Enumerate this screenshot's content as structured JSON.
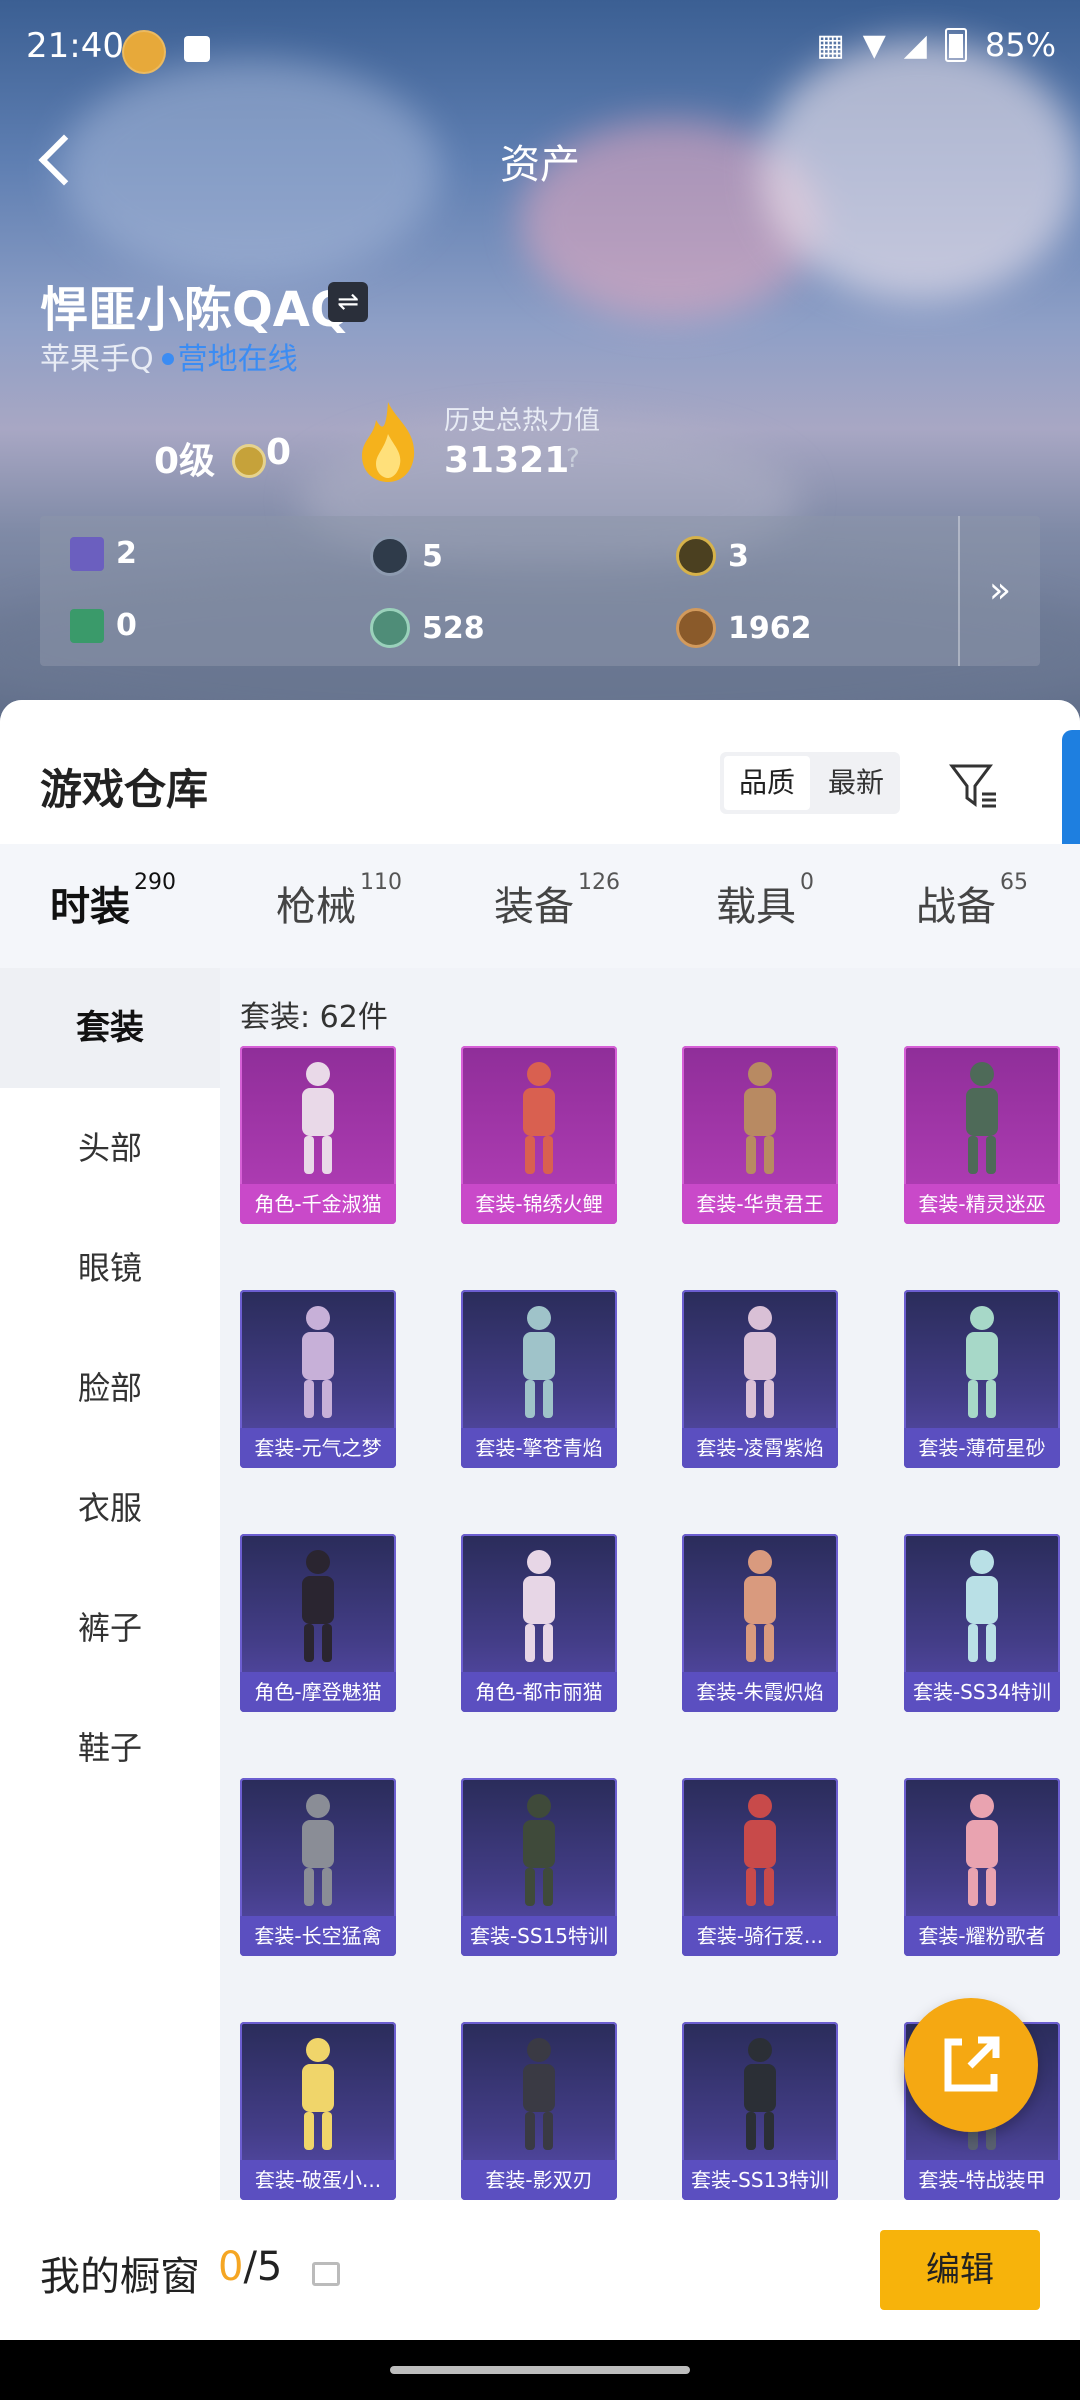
{
  "status_bar": {
    "time": "21:40",
    "battery": "85%"
  },
  "header": {
    "title": "资产"
  },
  "profile": {
    "name": "悍匪小陈QAQ",
    "swap_symbol": "⇌",
    "platform": "苹果手Q",
    "online_status": "营地在线",
    "level": "0级",
    "medal_value": "0",
    "history_label": "历史总热力值",
    "history_value": "31321",
    "help": "?"
  },
  "stats": [
    {
      "icon": "card-icon",
      "value": "2"
    },
    {
      "icon": "coin-s-icon",
      "value": "5"
    },
    {
      "icon": "coin-a-icon",
      "value": "3"
    },
    {
      "icon": "ticket-icon",
      "value": "0"
    },
    {
      "icon": "gem-icon",
      "value": "528"
    },
    {
      "icon": "bronze-coin-icon",
      "value": "1962"
    }
  ],
  "stats_more": "»",
  "warehouse": {
    "title": "游戏仓库",
    "sort_quality": "品质",
    "sort_latest": "最新"
  },
  "tabs": [
    {
      "label": "时装",
      "count": "290"
    },
    {
      "label": "枪械",
      "count": "110"
    },
    {
      "label": "装备",
      "count": "126"
    },
    {
      "label": "载具",
      "count": "0"
    },
    {
      "label": "战备",
      "count": "65"
    }
  ],
  "categories": [
    "套装",
    "头部",
    "眼镜",
    "脸部",
    "衣服",
    "裤子",
    "鞋子"
  ],
  "items_count_text": "套装: 62件",
  "items": [
    {
      "label": "角色-千金淑猫",
      "tier": "purple"
    },
    {
      "label": "套装-锦绣火鲤",
      "tier": "purple"
    },
    {
      "label": "套装-华贵君王",
      "tier": "purple"
    },
    {
      "label": "套装-精灵迷巫",
      "tier": "purple"
    },
    {
      "label": "套装-元气之梦",
      "tier": "blue"
    },
    {
      "label": "套装-擎苍青焰",
      "tier": "blue"
    },
    {
      "label": "套装-凌霄紫焰",
      "tier": "blue"
    },
    {
      "label": "套装-薄荷星砂",
      "tier": "blue"
    },
    {
      "label": "角色-摩登魅猫",
      "tier": "blue"
    },
    {
      "label": "角色-都市丽猫",
      "tier": "blue"
    },
    {
      "label": "套装-朱霞炽焰",
      "tier": "blue"
    },
    {
      "label": "套装-SS34特训",
      "tier": "blue"
    },
    {
      "label": "套装-长空猛禽",
      "tier": "blue"
    },
    {
      "label": "套装-SS15特训",
      "tier": "blue"
    },
    {
      "label": "套装-骑行爱...",
      "tier": "blue"
    },
    {
      "label": "套装-耀粉歌者",
      "tier": "blue"
    },
    {
      "label": "套装-破蛋小...",
      "tier": "blue"
    },
    {
      "label": "套装-影双刃",
      "tier": "blue"
    },
    {
      "label": "套装-SS13特训",
      "tier": "blue"
    },
    {
      "label": "套装-特战装甲",
      "tier": "blue"
    }
  ],
  "showcase": {
    "title": "我的橱窗",
    "used": "0",
    "total": "/5",
    "edit_label": "编辑"
  }
}
